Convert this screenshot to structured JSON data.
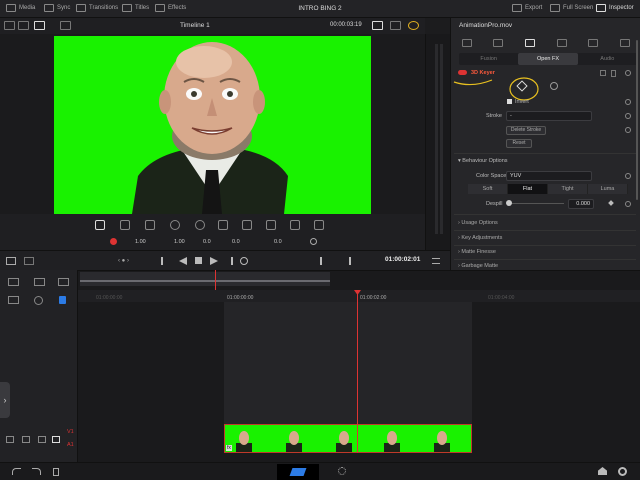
{
  "topbar": {
    "media": "Media",
    "sync": "Sync",
    "transitions": "Transitions",
    "titles": "Titles",
    "effects": "Effects",
    "project_title": "INTRO BING 2",
    "export": "Export",
    "fullscreen": "Full Screen",
    "inspector": "Inspector"
  },
  "viewer": {
    "timeline_name": "Timeline 1",
    "timecode": "00:00:03:19"
  },
  "viewer_tools": {
    "zoom_1": "1.00",
    "zoom_2": "1.00",
    "rot": "0.0",
    "val_1": "0.0",
    "val_2": "0.0"
  },
  "inspector": {
    "file_name": "AnimationPro.mov",
    "tabs": [
      "Fusion",
      "Open FX",
      "Audio"
    ],
    "effect_name": "3D Keyer",
    "invert_label": "Invert",
    "stroke_label": "Stroke",
    "stroke_value": "-",
    "delete_stroke": "Delete Stroke",
    "reset": "Reset",
    "behaviour_options": "Behaviour Options",
    "color_space_label": "Color Space",
    "color_space_value": "YUV",
    "modes": [
      "Soft",
      "Flat",
      "Tight",
      "Luma"
    ],
    "active_mode": "Flat",
    "despill_label": "Despill",
    "despill_value": "0.000",
    "despill_fraction": 0.0,
    "usage_options": "Usage Options",
    "key_adjustments": "Key Adjustments",
    "matte_finesse": "Matte Finesse",
    "garbage_matte": "Garbage Matte"
  },
  "transport": {
    "timecode": "01:00:02:01"
  },
  "timeline": {
    "ruler_marks": [
      "01:00:00:00",
      "01:00:02:00",
      "01:00:04:00"
    ],
    "ghost_mark": "01:00:00:00",
    "video_track": "V1",
    "audio_track": "A1",
    "fx_badge": "fx"
  },
  "colors": {
    "greenscreen": "#19f200",
    "accent_red": "#d33333",
    "bg_dark": "#1c1c1e"
  }
}
